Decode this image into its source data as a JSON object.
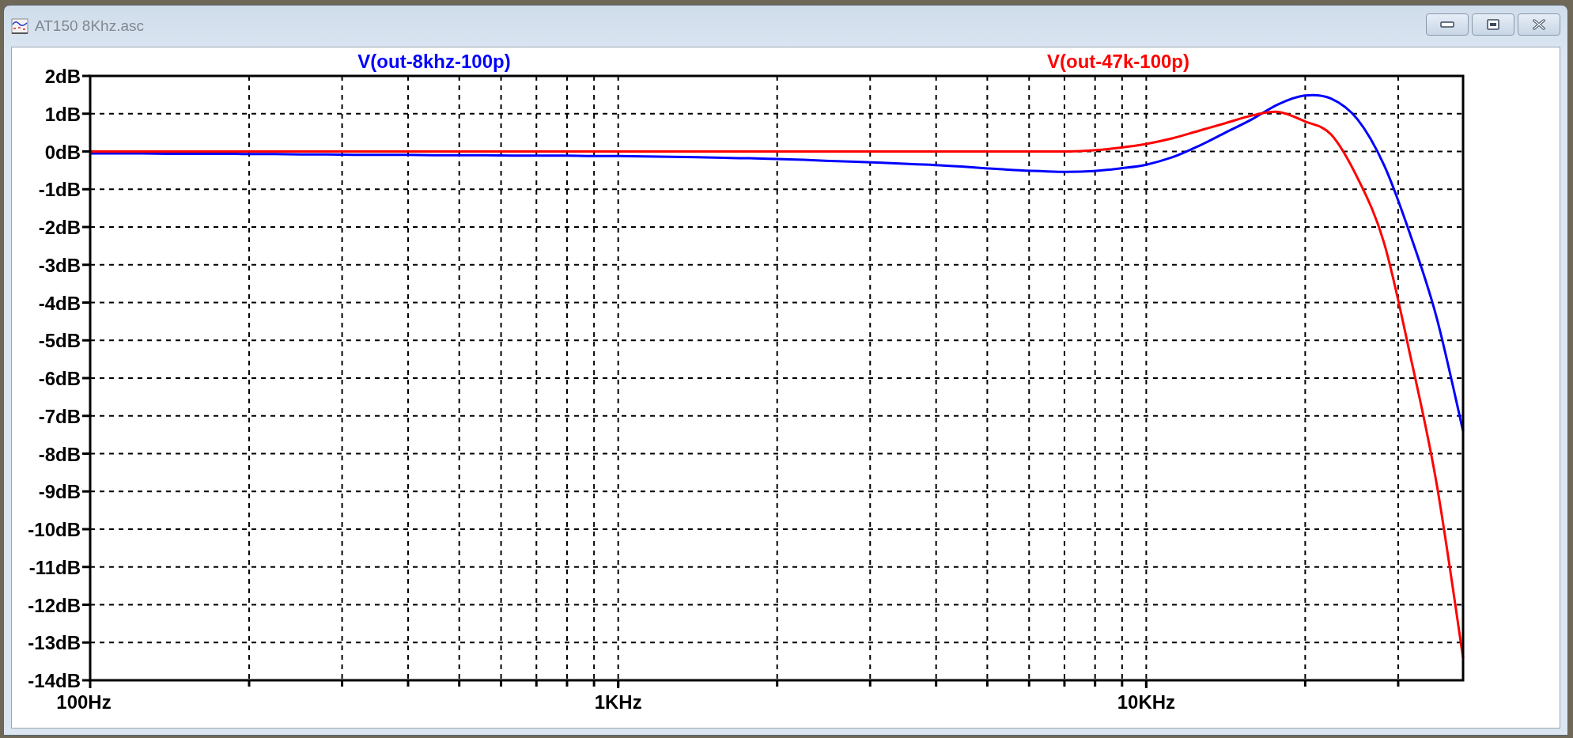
{
  "window": {
    "title": "AT150 8Khz.asc"
  },
  "plot": {
    "chart_data": {
      "type": "line",
      "categories": [
        "100Hz",
        null,
        null,
        null,
        null,
        null,
        null,
        null,
        null,
        null,
        null,
        null,
        null,
        null,
        null,
        null,
        null,
        null,
        null,
        null,
        "1KHz",
        null,
        null,
        null,
        null,
        null,
        null,
        null,
        null,
        null,
        null,
        null,
        null,
        null,
        null,
        null,
        null,
        null,
        null,
        null,
        "10KHz",
        null,
        null,
        null,
        null,
        null,
        null,
        null,
        null,
        null,
        null,
        null,
        null
      ],
      "series": [
        {
          "name": "V(out-8khz-100p)",
          "color": "#0000ff",
          "values": [
            -0.05,
            -0.05,
            -0.05,
            -0.06,
            -0.06,
            -0.06,
            -0.07,
            -0.07,
            -0.08,
            -0.08,
            -0.09,
            -0.09,
            -0.09,
            -0.1,
            -0.1,
            -0.1,
            -0.11,
            -0.11,
            -0.11,
            -0.12,
            -0.12,
            -0.13,
            -0.14,
            -0.15,
            -0.17,
            -0.18,
            -0.2,
            -0.22,
            -0.25,
            -0.27,
            -0.3,
            -0.33,
            -0.36,
            -0.4,
            -0.45,
            -0.49,
            -0.52,
            -0.54,
            -0.52,
            -0.45,
            -0.35,
            -0.15,
            0.15,
            0.5,
            0.85,
            1.25,
            1.48,
            1.4,
            0.85,
            -0.35,
            -2.2,
            -4.4,
            -7.4
          ]
        },
        {
          "name": "V(out-47k-100p)",
          "color": "#ff0000",
          "values": [
            0,
            0,
            0,
            0,
            0,
            0,
            0,
            0,
            0,
            0,
            0,
            0,
            0,
            0,
            0,
            0,
            0,
            0,
            0,
            0,
            0,
            0,
            0,
            0,
            0,
            0,
            0,
            0,
            0,
            0,
            0,
            0,
            0,
            0,
            0,
            0,
            0,
            0,
            0.03,
            0.1,
            0.2,
            0.35,
            0.55,
            0.75,
            0.95,
            1.05,
            0.8,
            0.45,
            -0.7,
            -2.4,
            -5.4,
            -8.8,
            -13.4
          ]
        }
      ],
      "grid": true,
      "ylim": [
        -14,
        2
      ],
      "yticks": [
        {
          "value": 2,
          "label": "2dB"
        },
        {
          "value": 1,
          "label": "1dB"
        },
        {
          "value": 0,
          "label": "0dB"
        },
        {
          "value": -1,
          "label": "-1dB"
        },
        {
          "value": -2,
          "label": "-2dB"
        },
        {
          "value": -3,
          "label": "-3dB"
        },
        {
          "value": -4,
          "label": "-4dB"
        },
        {
          "value": -5,
          "label": "-5dB"
        },
        {
          "value": -6,
          "label": "-6dB"
        },
        {
          "value": -7,
          "label": "-7dB"
        },
        {
          "value": -8,
          "label": "-8dB"
        },
        {
          "value": -9,
          "label": "-9dB"
        },
        {
          "value": -10,
          "label": "-10dB"
        },
        {
          "value": -11,
          "label": "-11dB"
        },
        {
          "value": -12,
          "label": "-12dB"
        },
        {
          "value": -13,
          "label": "-13dB"
        },
        {
          "value": -14,
          "label": "-14dB"
        }
      ]
    }
  }
}
